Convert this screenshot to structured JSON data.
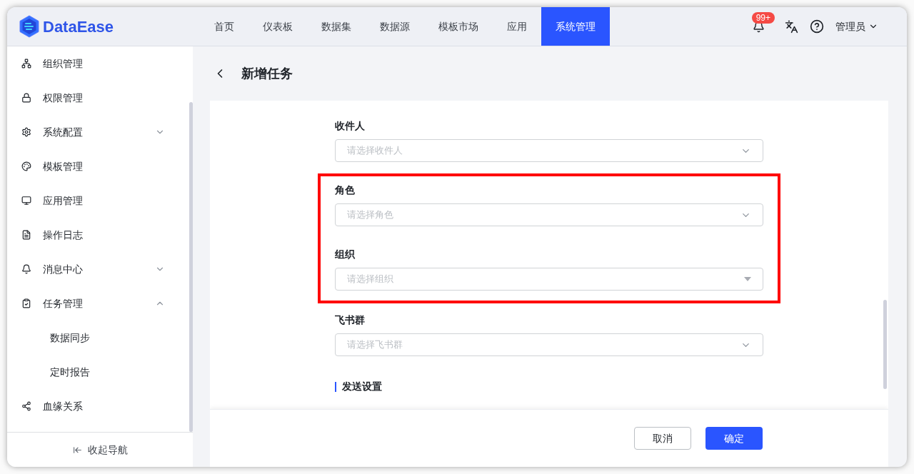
{
  "header": {
    "logo": "DataEase",
    "nav": [
      {
        "label": "首页",
        "selected": false
      },
      {
        "label": "仪表板",
        "selected": false
      },
      {
        "label": "数据集",
        "selected": false
      },
      {
        "label": "数据源",
        "selected": false
      },
      {
        "label": "模板市场",
        "selected": false
      },
      {
        "label": "应用",
        "selected": false
      },
      {
        "label": "系统管理",
        "selected": true
      }
    ],
    "badge": "99+",
    "user": "管理员"
  },
  "sidebar": {
    "items": [
      {
        "label": "组织管理"
      },
      {
        "label": "权限管理"
      },
      {
        "label": "系统配置",
        "expanded": false
      },
      {
        "label": "模板管理"
      },
      {
        "label": "应用管理"
      },
      {
        "label": "操作日志"
      },
      {
        "label": "消息中心",
        "expanded": false
      },
      {
        "label": "任务管理",
        "expanded": true,
        "children": [
          {
            "label": "数据同步"
          },
          {
            "label": "定时报告"
          }
        ]
      },
      {
        "label": "血缘关系"
      }
    ],
    "collapse": "收起导航"
  },
  "page": {
    "title": "新增任务"
  },
  "form": {
    "fields": [
      {
        "label": "收件人",
        "placeholder": "请选择收件人",
        "kind": "chevron",
        "highlighted": false
      },
      {
        "label": "角色",
        "placeholder": "请选择角色",
        "kind": "chevron",
        "highlighted": true
      },
      {
        "label": "组织",
        "placeholder": "请选择组织",
        "kind": "triangle",
        "highlighted": true
      },
      {
        "label": "飞书群",
        "placeholder": "请选择飞书群",
        "kind": "chevron",
        "highlighted": false
      }
    ],
    "section": "发送设置"
  },
  "footer": {
    "buttons": [
      {
        "label": "取消",
        "kind": "secondary"
      },
      {
        "label": "确定",
        "kind": "primary"
      }
    ]
  }
}
